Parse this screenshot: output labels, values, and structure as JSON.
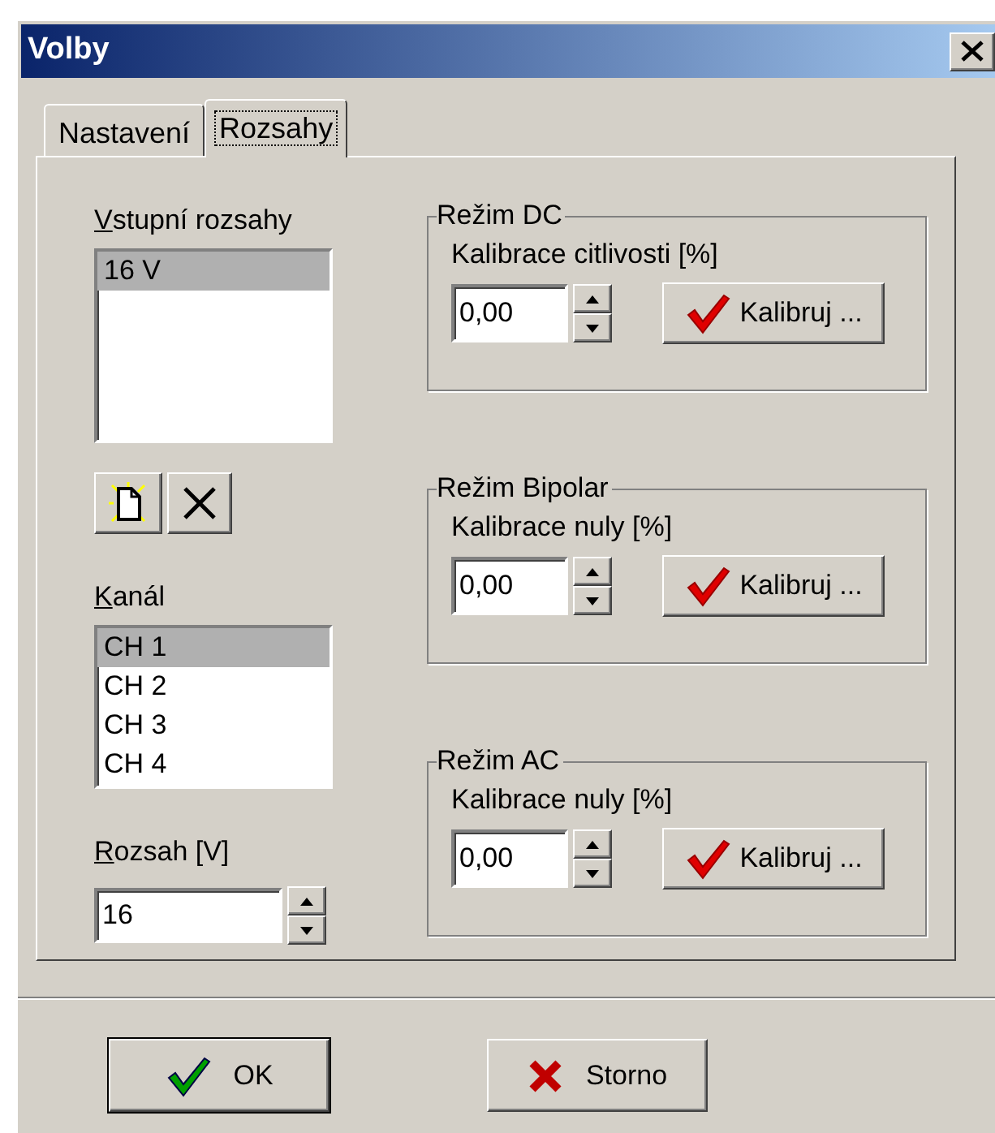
{
  "window": {
    "title": "Volby"
  },
  "tabs": [
    {
      "label": "Nastavení",
      "selected": false
    },
    {
      "label": "Rozsahy",
      "selected": true
    }
  ],
  "input_ranges": {
    "label": "Vstupní rozsahy",
    "items": [
      {
        "label": "16 V",
        "selected": true
      }
    ]
  },
  "channel": {
    "label": "Kanál",
    "items": [
      {
        "label": "CH 1",
        "selected": true
      },
      {
        "label": "CH 2",
        "selected": false
      },
      {
        "label": "CH 3",
        "selected": false
      },
      {
        "label": "CH 4",
        "selected": false
      }
    ]
  },
  "range": {
    "label": "Rozsah [V]",
    "value": "16"
  },
  "groups": [
    {
      "title": "Režim DC",
      "label": "Kalibrace citlivosti [%]",
      "value": "0,00",
      "button": "Kalibruj ..."
    },
    {
      "title": "Režim Bipolar",
      "label": "Kalibrace nuly [%]",
      "value": "0,00",
      "button": "Kalibruj ..."
    },
    {
      "title": "Režim AC",
      "label": "Kalibrace nuly [%]",
      "value": "0,00",
      "button": "Kalibruj ..."
    }
  ],
  "buttons": [
    {
      "kind": "ok",
      "label": "OK"
    },
    {
      "kind": "cancel",
      "label": "Storno"
    }
  ]
}
